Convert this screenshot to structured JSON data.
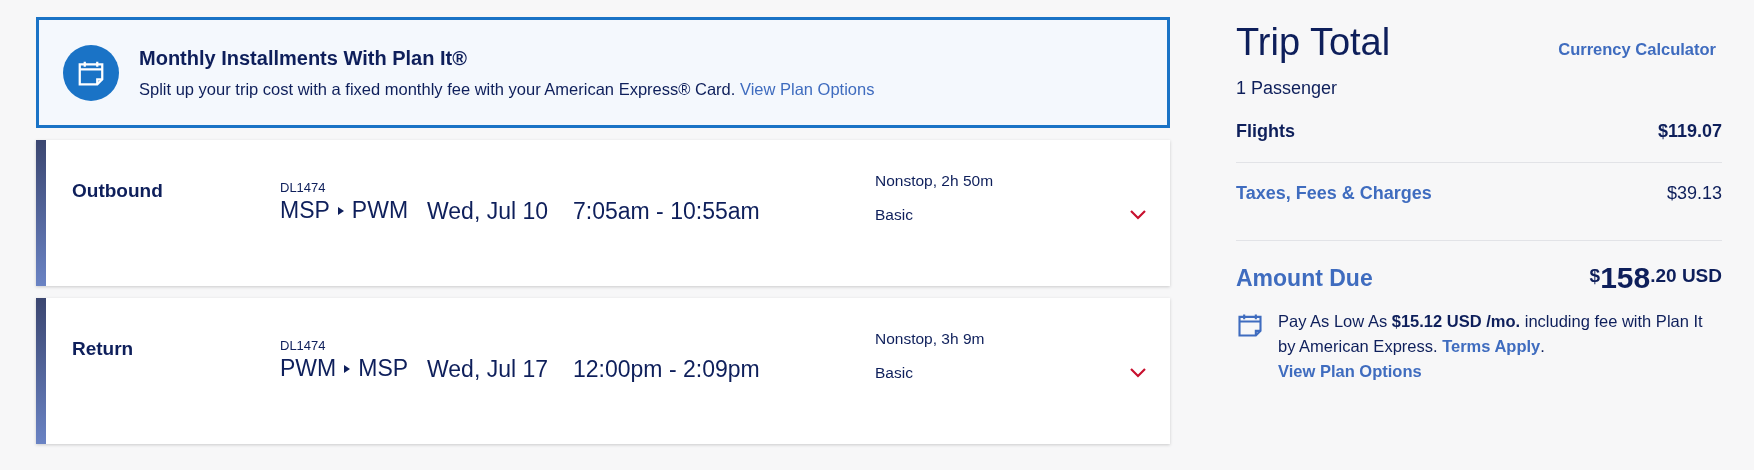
{
  "plan_banner": {
    "title": "Monthly Installments With Plan It®",
    "text": "Split up your trip cost with a fixed monthly fee with your American Express® Card.",
    "link": "View Plan Options"
  },
  "legs": [
    {
      "label": "Outbound",
      "flight_number": "DL1474",
      "origin": "MSP",
      "destination": "PWM",
      "date": "Wed, Jul 10",
      "times": "7:05am - 10:55am",
      "stops": "Nonstop, 2h 50m",
      "fare_class": "Basic",
      "expanded": false
    },
    {
      "label": "Return",
      "flight_number": "DL1474",
      "origin": "PWM",
      "destination": "MSP",
      "date": "Wed, Jul 17",
      "times": "12:00pm - 2:09pm",
      "stops": "Nonstop, 3h 9m",
      "fare_class": "Basic",
      "expanded": false
    }
  ],
  "summary": {
    "title": "Trip Total",
    "currency_link": "Currency Calculator",
    "passengers": "1 Passenger",
    "lines": [
      {
        "label": "Flights",
        "amount": "$119.07",
        "kind": "plain"
      },
      {
        "label": "Taxes, Fees & Charges",
        "amount": "$39.13",
        "kind": "link"
      }
    ],
    "amount_due": {
      "label": "Amount Due",
      "symbol": "$",
      "whole": "158",
      "cents": ".20 USD"
    },
    "plan_note": {
      "text": "Pay As Low As **$15.12 USD /mo.** including fee with Plan It by American Express.",
      "terms_link": "Terms Apply",
      "end": ".",
      "link": "View Plan Options"
    }
  }
}
